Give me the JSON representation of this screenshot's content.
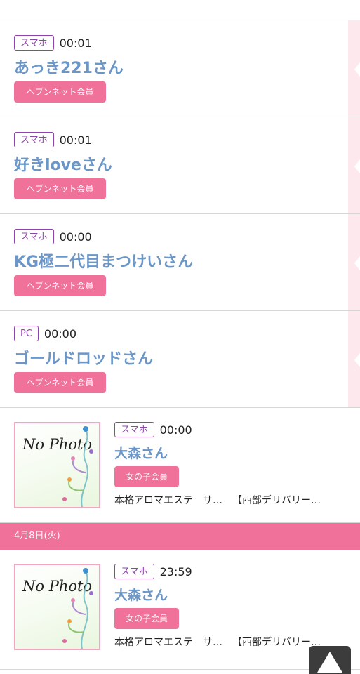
{
  "entries": [
    {
      "device": "スマホ",
      "time": "00:01",
      "name": "あっき221さん",
      "member": "ヘブンネット会員"
    },
    {
      "device": "スマホ",
      "time": "00:01",
      "name": "好きloveさん",
      "member": "ヘブンネット会員"
    },
    {
      "device": "スマホ",
      "time": "00:00",
      "name": "KG極二代目まつけいさん",
      "member": "ヘブンネット会員"
    },
    {
      "device": "PC",
      "time": "00:00",
      "name": "ゴールドロッドさん",
      "member": "ヘブンネット会員"
    }
  ],
  "photo_entries": [
    {
      "photo_text": "No Photo",
      "device": "スマホ",
      "time": "00:00",
      "name": "大森さん",
      "member": "女の子会員",
      "shop1": "本格アロマエステ",
      "shop2": "サ…",
      "shop3": "【西部デリバリー…"
    },
    {
      "photo_text": "No Photo",
      "device": "スマホ",
      "time": "23:59",
      "name": "大森さん",
      "member": "女の子会員",
      "shop1": "本格アロマエステ",
      "shop2": "サ…",
      "shop3": "【西部デリバリー…"
    }
  ],
  "date_bar": "4月8日(火)",
  "colors": {
    "accent": "#f0719a",
    "name": "#6b96c8",
    "device_border": "#8e44ad",
    "rail": "#fde8ee"
  },
  "icons": {
    "scroll_top": "up-arrow-icon"
  }
}
